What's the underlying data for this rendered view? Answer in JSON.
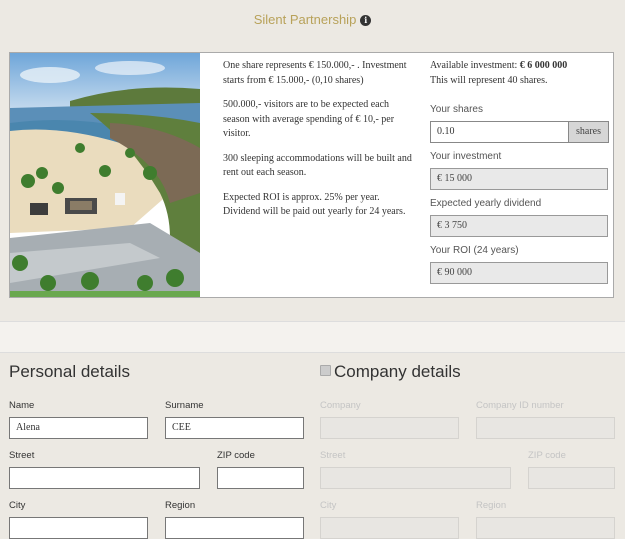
{
  "header": {
    "title": "Silent Partnership",
    "info_icon": "info-icon"
  },
  "description": [
    "One share represents € 150.000,- . Investment starts from € 15.000,- (0,10 shares)",
    "500.000,- visitors are to be expected each season with average spending of € 10,- per visitor.",
    "300 sleeping accommodations will be built and rent out each season.",
    "Expected ROI is approx. 25% per year. Dividend will be paid out yearly for 24 years."
  ],
  "investment": {
    "available_prefix": "Available investment: ",
    "available_value": "€ 6 000 000",
    "shares_note": "This will represent 40 shares.",
    "your_shares_label": "Your shares",
    "your_shares_value": "0.10",
    "shares_addon": "shares",
    "your_investment_label": "Your investment",
    "your_investment_value": "€ 15 000",
    "dividend_label": "Expected yearly dividend",
    "dividend_value": "€ 3 750",
    "roi_label": "Your ROI (24 years)",
    "roi_value": "€ 90 000"
  },
  "personal": {
    "heading": "Personal details",
    "name_label": "Name",
    "name_value": "Alena",
    "surname_label": "Surname",
    "surname_value": "CEE",
    "street_label": "Street",
    "street_value": "",
    "zip_label": "ZIP code",
    "zip_value": "",
    "city_label": "City",
    "city_value": "",
    "region_label": "Region",
    "region_value": ""
  },
  "company": {
    "heading": "Company details",
    "company_label": "Company",
    "company_id_label": "Company ID number",
    "street_label": "Street",
    "zip_label": "ZIP code",
    "city_label": "City",
    "region_label": "Region"
  },
  "colors": {
    "accent": "#b8a25a",
    "background": "#ece9e3"
  }
}
